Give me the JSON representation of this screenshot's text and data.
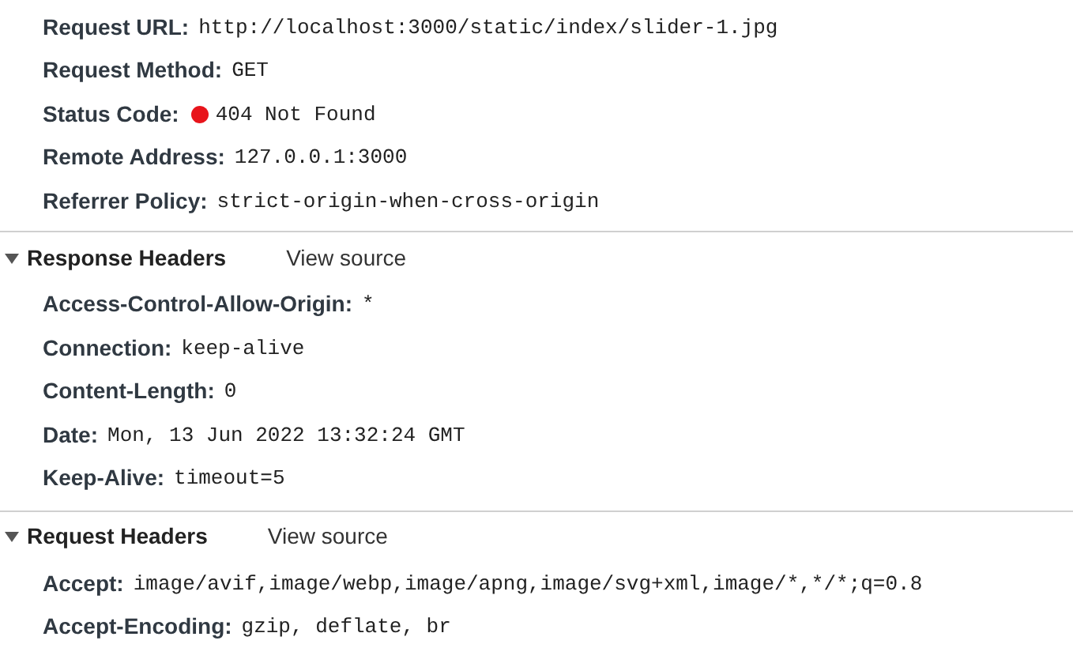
{
  "general": {
    "rows": [
      {
        "label": "Request URL:",
        "value": "http://localhost:3000/static/index/slider-1.jpg"
      },
      {
        "label": "Request Method:",
        "value": "GET"
      },
      {
        "label": "Status Code:",
        "value": "404 Not Found",
        "color": "#e8141b"
      },
      {
        "label": "Remote Address:",
        "value": "127.0.0.1:3000"
      },
      {
        "label": "Referrer Policy:",
        "value": "strict-origin-when-cross-origin"
      }
    ]
  },
  "sections": [
    {
      "title": "Response Headers",
      "link": "View source",
      "expanded": true,
      "rows": [
        {
          "label": "Access-Control-Allow-Origin:",
          "value": "*"
        },
        {
          "label": "Connection:",
          "value": "keep-alive"
        },
        {
          "label": "Content-Length:",
          "value": "0"
        },
        {
          "label": "Date:",
          "value": "Mon, 13 Jun 2022 13:32:24 GMT"
        },
        {
          "label": "Keep-Alive:",
          "value": "timeout=5"
        }
      ]
    },
    {
      "title": "Request Headers",
      "link": "View source",
      "expanded": true,
      "rows": [
        {
          "label": "Accept:",
          "value": "image/avif,image/webp,image/apng,image/svg+xml,image/*,*/*;q=0.8"
        },
        {
          "label": "Accept-Encoding:",
          "value": "gzip, deflate, br"
        }
      ]
    }
  ]
}
